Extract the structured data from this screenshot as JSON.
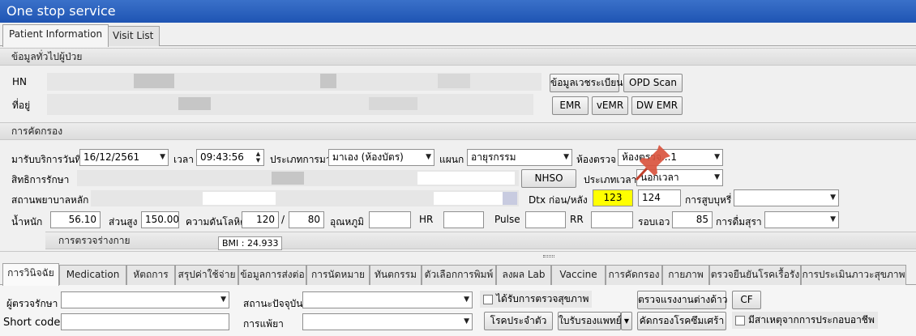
{
  "window": {
    "title": "One stop service"
  },
  "top_tabs": [
    "Patient Information",
    "Visit List"
  ],
  "general": {
    "header": "ข้อมูลทั่วไปผู้ป่วย",
    "hn_label": "HN",
    "address_label": "ที่อยู่",
    "buttons": {
      "registration": "ข้อมูลเวชระเบียน",
      "opd_scan": "OPD Scan",
      "emr": "EMR",
      "vemr": "vEMR",
      "dw_emr": "DW EMR"
    }
  },
  "screening": {
    "header": "การคัดกรอง",
    "date_label": "มารับบริการวันที่",
    "date_value": "16/12/2561",
    "time_label": "เวลา",
    "time_value": "09:43:56",
    "visit_type_label": "ประเภทการมา",
    "visit_type_value": "มาเอง (ห้องบัตร)",
    "department_label": "แผนก",
    "department_value": "อายุรกรรม",
    "room_label": "ห้องตรวจ",
    "room_value": "ห้องตรวจ...1",
    "rights_label": "สิทธิการรักษา",
    "nhso_button": "NHSO",
    "time_type_label": "ประเภทเวลา",
    "time_type_value": "นอกเวลา",
    "main_hospital_label": "สถานพยาบาลหลัก",
    "dtx_label": "Dtx ก่อน/หลัง",
    "dtx_before": "123",
    "dtx_after": "124",
    "smoking_label": "การสูบบุหรี่",
    "weight_label": "น้ำหนัก",
    "weight_value": "56.10",
    "height_label": "ส่วนสูง",
    "height_value": "150.00",
    "bp_label": "ความดันโลหิต",
    "bp_sys": "120",
    "bp_slash": "/",
    "bp_dia": "80",
    "temp_label": "อุณหภูมิ",
    "hr_label": "HR",
    "pulse_label": "Pulse",
    "rr_label": "RR",
    "waist_label": "รอบเอว",
    "waist_value": "85",
    "alcohol_label": "การดื่มสุรา",
    "pe_header": "การตรวจร่างกาย",
    "bmi": "BMI : 24.933"
  },
  "bottom_tabs": [
    "การวินิจฉัย",
    "Medication",
    "หัตถการ",
    "สรุปค่าใช้จ่าย",
    "ข้อมูลการส่งต่อ",
    "การนัดหมาย",
    "ทันตกรรม",
    "ตัวเลือกการพิมพ์",
    "ลงผล Lab",
    "Vaccine",
    "การคัดกรอง",
    "กายภาพ",
    "ตรวจยืนยันโรคเรื้อรัง",
    "การประเมินภาวะสุขภาพ"
  ],
  "diagnosis": {
    "doctor_label": "ผู้ตรวจรักษา",
    "status_label": "สถานะปัจจุบัน",
    "health_check_label": "ได้รับการตรวจสุขภาพ",
    "foreign_worker_button": "ตรวจแรงงานต่างด้าว",
    "cf_button": "CF",
    "short_code_label": "Short code",
    "discharge_label": "การแพ้ยา",
    "chronic_button": "โรคประจำตัว",
    "certificate_button": "ใบรับรองแพทย์",
    "chronic_screen_button": "คัดกรองโรคซึมเศร้า",
    "occupational_label": "มีสาเหตุจากการประกอบอาชีพ"
  }
}
